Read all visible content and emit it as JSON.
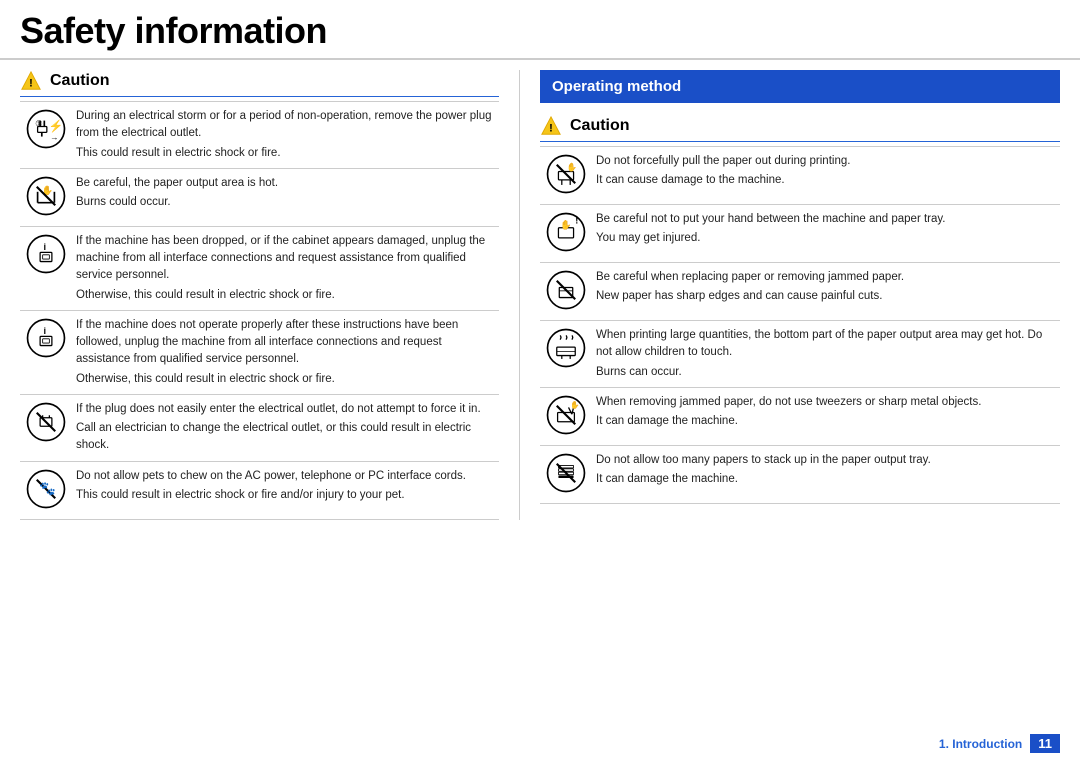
{
  "header": {
    "title": "Safety information"
  },
  "left_section": {
    "caution_label": "Caution",
    "rows": [
      {
        "icon": "lightning-plug",
        "primary": "During an electrical storm or for a period of non-operation, remove the power plug from the electrical outlet.",
        "secondary": "This could result in electric shock or fire."
      },
      {
        "icon": "hot-output",
        "primary": "Be careful, the paper output area is hot.",
        "secondary": "Burns could occur."
      },
      {
        "icon": "info-circle",
        "primary": "If the machine has been dropped, or if the cabinet appears damaged, unplug the machine from all interface connections and request assistance from qualified service personnel.",
        "secondary": "Otherwise, this could result in electric shock or fire."
      },
      {
        "icon": "info-circle",
        "primary": "If the machine does not operate properly after these instructions have been followed, unplug the machine from all interface connections and request assistance from qualified service personnel.",
        "secondary": "Otherwise, this could result in electric shock or fire."
      },
      {
        "icon": "no-circle",
        "primary": "If the plug does not easily enter the electrical outlet, do not attempt to force it in.",
        "secondary": "Call an electrician to change the electrical outlet, or this could result in electric shock."
      },
      {
        "icon": "no-circle",
        "primary": "Do not allow pets to chew on the AC power, telephone or PC interface cords.",
        "secondary": "This could result in electric shock or fire and/or injury to your pet."
      }
    ]
  },
  "right_section": {
    "operating_method_label": "Operating method",
    "caution_label": "Caution",
    "rows": [
      {
        "icon": "no-pull-paper",
        "primary": "Do not forcefully pull the paper out during printing.",
        "secondary": "It can cause damage to the machine."
      },
      {
        "icon": "hand-tray",
        "primary": "Be careful not to put your hand between the machine and paper tray.",
        "secondary": "You may get injured."
      },
      {
        "icon": "no-paper-replace",
        "primary": "Be careful when replacing paper or removing jammed paper.",
        "secondary": "New paper has sharp edges and can cause painful cuts."
      },
      {
        "icon": "hot-output-steam",
        "primary": "When printing large quantities, the bottom part of the paper output area may get hot. Do not allow children to touch.",
        "secondary": "Burns can occur."
      },
      {
        "icon": "no-tweezers",
        "primary": "When removing jammed paper, do not use tweezers or sharp metal objects.",
        "secondary": "It can damage the machine."
      },
      {
        "icon": "no-stack",
        "primary": "Do not allow too many papers to stack up in the paper output tray.",
        "secondary": "It can damage the machine."
      }
    ]
  },
  "footer": {
    "section": "1. Introduction",
    "page": "11"
  }
}
